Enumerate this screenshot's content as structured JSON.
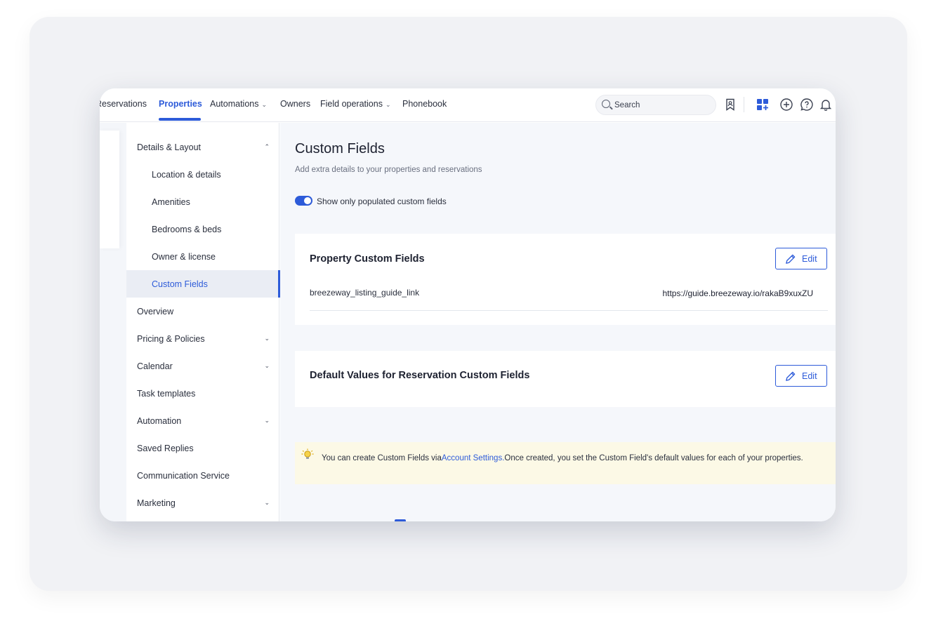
{
  "nav": {
    "items": [
      {
        "label": "Reservations",
        "active": false,
        "dropdown": false
      },
      {
        "label": "Properties",
        "active": true,
        "dropdown": false
      },
      {
        "label": "Automations",
        "active": false,
        "dropdown": true
      },
      {
        "label": "Owners",
        "active": false,
        "dropdown": false
      },
      {
        "label": "Field operations",
        "active": false,
        "dropdown": true
      },
      {
        "label": "Phonebook",
        "active": false,
        "dropdown": false
      }
    ],
    "search_placeholder": "Search",
    "icons": [
      "bookmark-person-icon",
      "apps-grid-icon",
      "plus-circle-icon",
      "help-chat-icon",
      "bell-icon"
    ]
  },
  "sidebar": {
    "items": [
      {
        "label": "Details & Layout",
        "expanded": true,
        "caret": "up"
      },
      {
        "label": "Location & details",
        "sub": true
      },
      {
        "label": "Amenities",
        "sub": true
      },
      {
        "label": "Bedrooms & beds",
        "sub": true
      },
      {
        "label": "Owner & license",
        "sub": true
      },
      {
        "label": "Custom Fields",
        "sub": true,
        "active": true
      },
      {
        "label": "Overview"
      },
      {
        "label": "Pricing & Policies",
        "caret": "down"
      },
      {
        "label": "Calendar",
        "caret": "down"
      },
      {
        "label": "Task templates"
      },
      {
        "label": "Automation",
        "caret": "down"
      },
      {
        "label": "Saved Replies"
      },
      {
        "label": "Communication Service"
      },
      {
        "label": "Marketing",
        "caret": "down"
      }
    ]
  },
  "main": {
    "title": "Custom Fields",
    "subtitle": "Add extra details to your properties and reservations",
    "toggle": {
      "label": "Show only populated custom fields",
      "on": true
    },
    "property_card": {
      "title": "Property Custom Fields",
      "edit_label": "Edit",
      "fields": [
        {
          "key": "breezeway_listing_guide_link",
          "value": "https://guide.breezeway.io/rakaB9xuxZU"
        }
      ]
    },
    "reservation_card": {
      "title": "Default Values for Reservation Custom Fields",
      "edit_label": "Edit"
    },
    "tip": {
      "before": "You can create Custom Fields via",
      "link": "Account Settings.",
      "after": "Once created, you set the Custom Field's default values for each of your properties."
    }
  },
  "colors": {
    "accent": "#2d5bd9",
    "tip_bg": "#fcf9e6",
    "main_bg": "#f5f7fb"
  }
}
